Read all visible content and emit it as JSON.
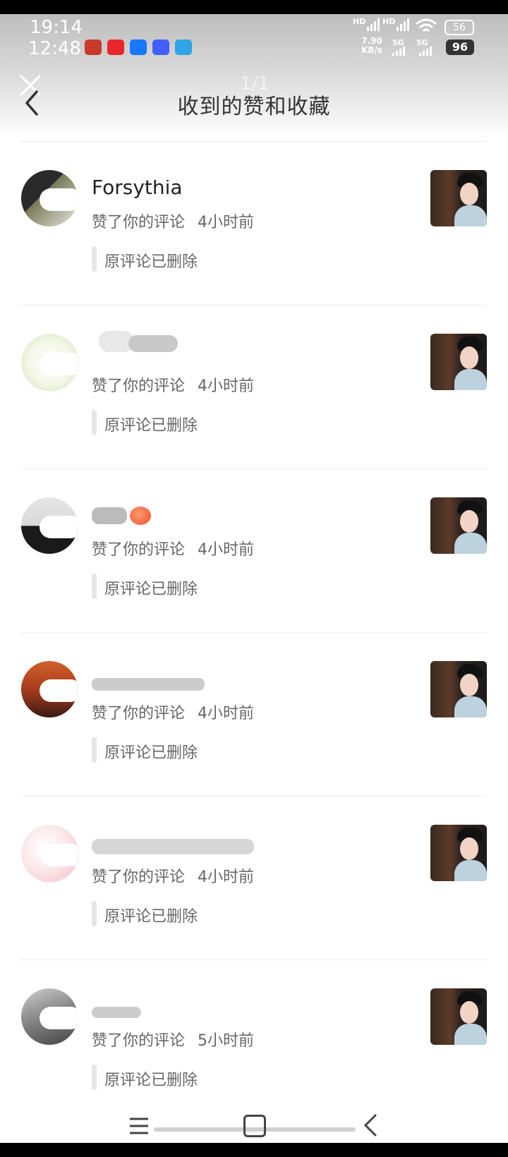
{
  "status_bar": {
    "time": "19:14",
    "time_secondary": "12:48",
    "hd1": "HD",
    "hd2": "HD",
    "net_speed": "7.90",
    "net_unit": "KB/s",
    "net1": "5G",
    "net2": "5G",
    "battery_top": "56",
    "battery_bottom": "96",
    "app_icon_colors": [
      "#c83a2a",
      "#e8262c",
      "#1677ff",
      "#415fff",
      "#2fa4e7"
    ]
  },
  "header": {
    "pager": "1/1",
    "title": "收到的赞和收藏",
    "back_icon": "chevron-left-icon",
    "close_icon": "close-icon"
  },
  "items": [
    {
      "username": "Forsythia",
      "action": "赞了你的评论",
      "time": "4小时前",
      "quote": "原评论已删除",
      "avatar_colors": [
        "#2a2a2a",
        "#7a7a5a"
      ]
    },
    {
      "username": "",
      "action": "赞了你的评论",
      "time": "4小时前",
      "quote": "原评论已删除",
      "avatar_colors": [
        "#f4f7e6",
        "#cfe0b0"
      ]
    },
    {
      "username": "",
      "action": "赞了你的评论",
      "time": "4小时前",
      "quote": "原评论已删除",
      "avatar_colors": [
        "#d9d9d9",
        "#1a1a1a"
      ]
    },
    {
      "username": "",
      "action": "赞了你的评论",
      "time": "4小时前",
      "quote": "原评论已删除",
      "avatar_colors": [
        "#d0602a",
        "#3a1a14"
      ]
    },
    {
      "username": "",
      "action": "赞了你的评论",
      "time": "4小时前",
      "quote": "原评论已删除",
      "avatar_colors": [
        "#fbe6e8",
        "#f3b9c3"
      ]
    },
    {
      "username": "",
      "action": "赞了你的评论",
      "time": "5小时前",
      "quote": "原评论已删除",
      "avatar_colors": [
        "#555555",
        "#aaaaaa"
      ]
    }
  ]
}
